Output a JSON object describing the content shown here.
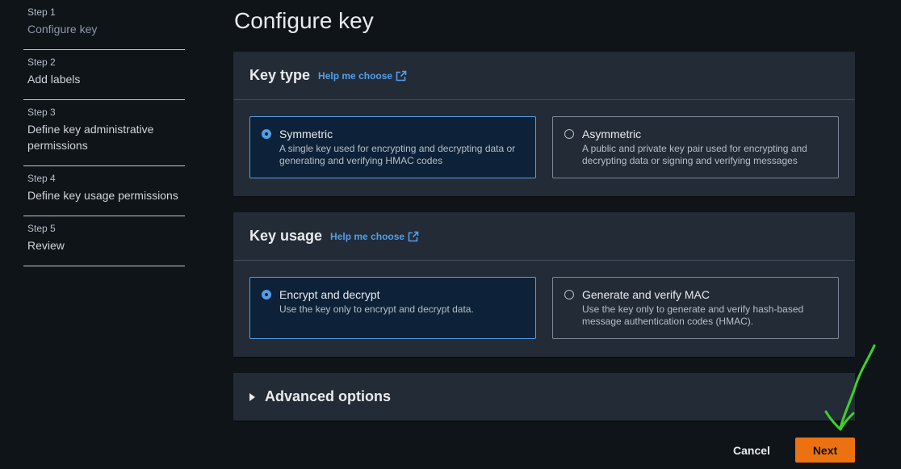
{
  "steps": [
    {
      "number": "Step 1",
      "title": "Configure key"
    },
    {
      "number": "Step 2",
      "title": "Add labels"
    },
    {
      "number": "Step 3",
      "title": "Define key administrative permissions"
    },
    {
      "number": "Step 4",
      "title": "Define key usage permissions"
    },
    {
      "number": "Step 5",
      "title": "Review"
    }
  ],
  "page_title": "Configure key",
  "key_type": {
    "title": "Key type",
    "help_link": "Help me choose",
    "options": [
      {
        "label": "Symmetric",
        "description": "A single key used for encrypting and decrypting data or generating and verifying HMAC codes",
        "selected": true
      },
      {
        "label": "Asymmetric",
        "description": "A public and private key pair used for encrypting and decrypting data or signing and verifying messages",
        "selected": false
      }
    ]
  },
  "key_usage": {
    "title": "Key usage",
    "help_link": "Help me choose",
    "options": [
      {
        "label": "Encrypt and decrypt",
        "description": "Use the key only to encrypt and decrypt data.",
        "selected": true
      },
      {
        "label": "Generate and verify MAC",
        "description": "Use the key only to generate and verify hash-based message authentication codes (HMAC).",
        "selected": false
      }
    ]
  },
  "advanced": {
    "label": "Advanced options"
  },
  "footer": {
    "cancel_label": "Cancel",
    "next_label": "Next"
  },
  "colors": {
    "accent": "#539fe5",
    "primary_button": "#ec7211",
    "annotation": "#3fd12a"
  }
}
